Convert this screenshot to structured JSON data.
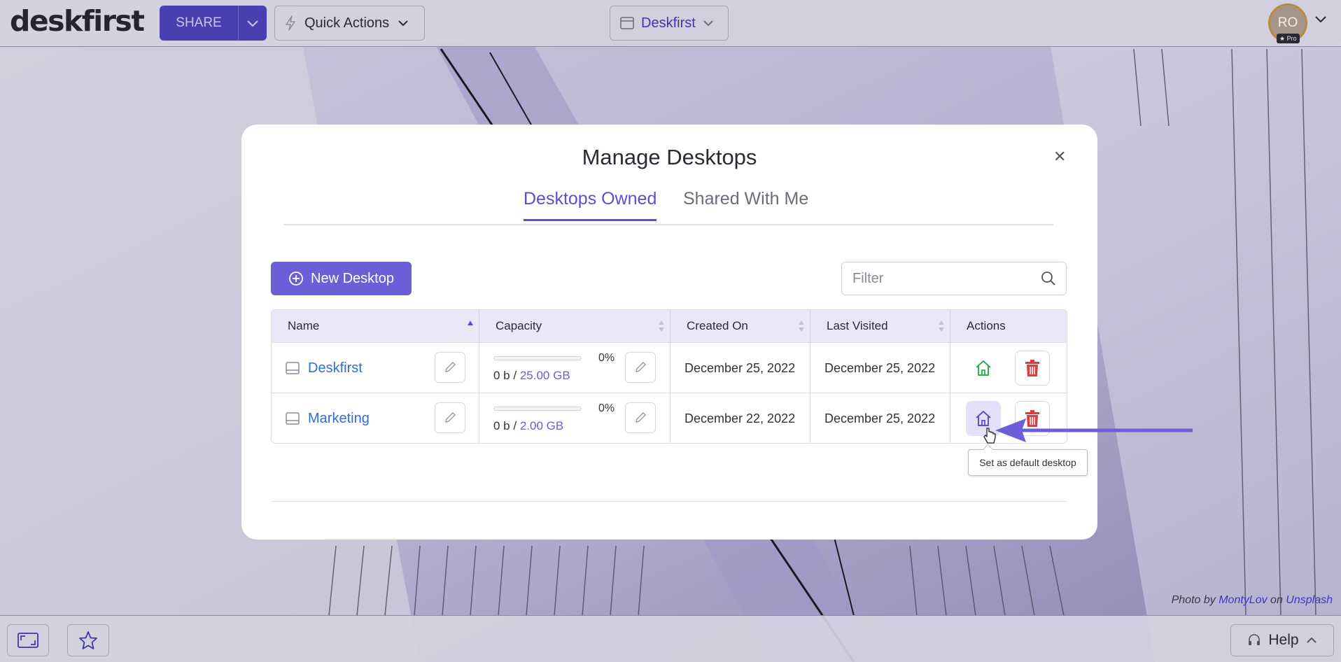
{
  "app": {
    "logo": "deskfirst"
  },
  "topbar": {
    "share_label": "SHARE",
    "quick_actions_label": "Quick Actions",
    "desktop_selector_label": "Deskfirst",
    "avatar_initials": "RO",
    "avatar_badge": "Pro"
  },
  "modal": {
    "title": "Manage Desktops",
    "tabs": [
      {
        "label": "Desktops Owned",
        "active": true
      },
      {
        "label": "Shared With Me",
        "active": false
      }
    ],
    "new_desktop_label": "New Desktop",
    "filter_placeholder": "Filter",
    "table": {
      "headers": [
        "Name",
        "Capacity",
        "Created On",
        "Last Visited",
        "Actions"
      ],
      "rows": [
        {
          "name": "Deskfirst",
          "capacity_pct": "0%",
          "capacity_used": "0 b /",
          "capacity_total": "25.00 GB",
          "created_on": "December 25, 2022",
          "last_visited": "December 25, 2022",
          "is_default": true
        },
        {
          "name": "Marketing",
          "capacity_pct": "0%",
          "capacity_used": "0 b /",
          "capacity_total": "2.00 GB",
          "created_on": "December 22, 2022",
          "last_visited": "December 25, 2022",
          "is_default": false
        }
      ]
    },
    "tooltip": "Set as default desktop"
  },
  "bottombar": {
    "help_label": "Help"
  },
  "credit": {
    "prefix": "Photo by",
    "author": "MontyLov",
    "on": "on",
    "site": "Unsplash"
  },
  "colors": {
    "accent": "#6b5ed6",
    "link": "#2c6fd6",
    "home_default": "#2bb04a",
    "delete": "#e03a3a"
  }
}
